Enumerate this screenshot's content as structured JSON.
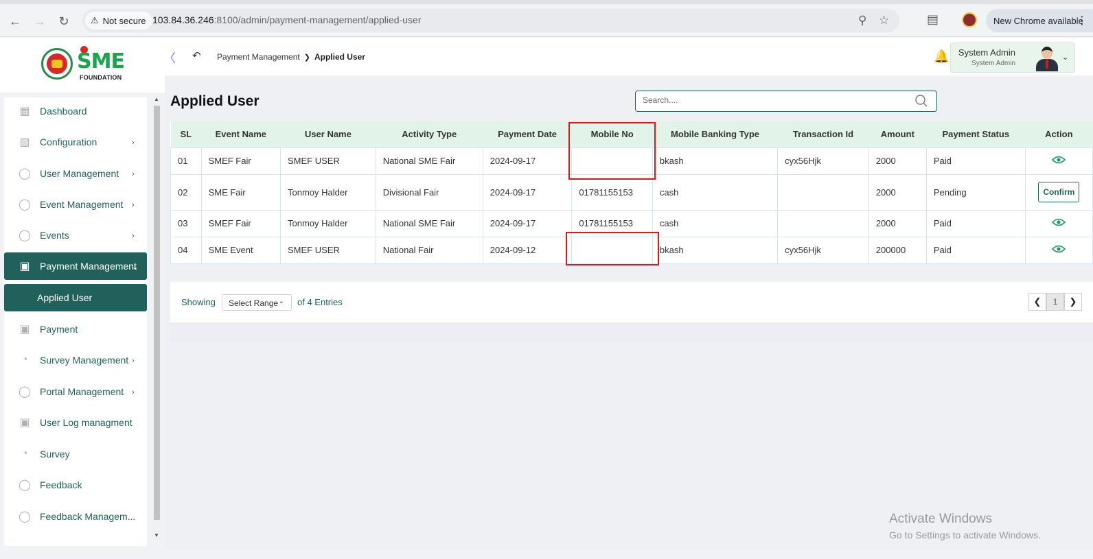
{
  "browser": {
    "security_label": "Not secure",
    "url_host": "103.84.36.246",
    "url_path": ":8100/admin/payment-management/applied-user",
    "update_label": "New Chrome available"
  },
  "brand": {
    "logo_word": "SME",
    "logo_sub": "FOUNDATION"
  },
  "sidebar": {
    "items": [
      {
        "label": "Dashboard",
        "icon": "grid-icon",
        "has_chevron": false
      },
      {
        "label": "Configuration",
        "icon": "settings-grid-icon",
        "has_chevron": true
      },
      {
        "label": "User Management",
        "icon": "dollar-icon",
        "has_chevron": true
      },
      {
        "label": "Event Management",
        "icon": "lock-icon",
        "has_chevron": true
      },
      {
        "label": "Events",
        "icon": "lock-icon",
        "has_chevron": true
      },
      {
        "label": "Payment Management",
        "icon": "money-icon",
        "has_chevron": true
      },
      {
        "label": "Applied User",
        "icon": "",
        "has_chevron": false
      },
      {
        "label": "Payment",
        "icon": "money-icon",
        "has_chevron": false
      },
      {
        "label": "Survey Management",
        "icon": "pie-icon",
        "has_chevron": true
      },
      {
        "label": "Portal Management",
        "icon": "lock-icon",
        "has_chevron": true
      },
      {
        "label": "User Log managment",
        "icon": "money-icon",
        "has_chevron": false
      },
      {
        "label": "Survey",
        "icon": "pie-icon",
        "has_chevron": false
      },
      {
        "label": "Feedback",
        "icon": "feedback-icon",
        "has_chevron": false
      },
      {
        "label": "Feedback Managem...",
        "icon": "feedback-icon",
        "has_chevron": false
      }
    ]
  },
  "header": {
    "breadcrumb_parent": "Payment Management",
    "breadcrumb_current": "Applied User",
    "user_name": "System Admin",
    "user_role": "System Admin"
  },
  "main": {
    "title": "Applied User",
    "search_placeholder": "Search....",
    "columns": [
      "SL",
      "Event Name",
      "User Name",
      "Activity Type",
      "Payment Date",
      "Mobile No",
      "Mobile Banking Type",
      "Transaction Id",
      "Amount",
      "Payment Status",
      "Action"
    ],
    "rows": [
      {
        "sl": "01",
        "event": "SMEF Fair",
        "user": "SMEF USER",
        "activity": "National SME Fair",
        "date": "2024-09-17",
        "mobile": "",
        "banking": "bkash",
        "txn": "cyx56Hjk",
        "amount": "2000",
        "status": "Paid",
        "action": "view"
      },
      {
        "sl": "02",
        "event": "SME Fair",
        "user": "Tonmoy Halder",
        "activity": "Divisional Fair",
        "date": "2024-09-17",
        "mobile": "01781155153",
        "banking": "cash",
        "txn": "",
        "amount": "2000",
        "status": "Pending",
        "action": "Confirm"
      },
      {
        "sl": "03",
        "event": "SMEF Fair",
        "user": "Tonmoy Halder",
        "activity": "National SME Fair",
        "date": "2024-09-17",
        "mobile": "01781155153",
        "banking": "cash",
        "txn": "",
        "amount": "2000",
        "status": "Paid",
        "action": "view"
      },
      {
        "sl": "04",
        "event": "SME Event",
        "user": "SMEF USER",
        "activity": "National Fair",
        "date": "2024-09-12",
        "mobile": "",
        "banking": "bkash",
        "txn": "cyx56Hjk",
        "amount": "200000",
        "status": "Paid",
        "action": "view"
      }
    ],
    "pagination": {
      "showing_label": "Showing",
      "range_label": "Select Range",
      "entries_label": "of 4 Entries",
      "current_page": "1"
    }
  },
  "watermark": {
    "line1": "Activate Windows",
    "line2": "Go to Settings to activate Windows."
  },
  "colors": {
    "primary": "#20625b",
    "header_bg": "#e2f3ea",
    "highlight": "#e01818"
  }
}
